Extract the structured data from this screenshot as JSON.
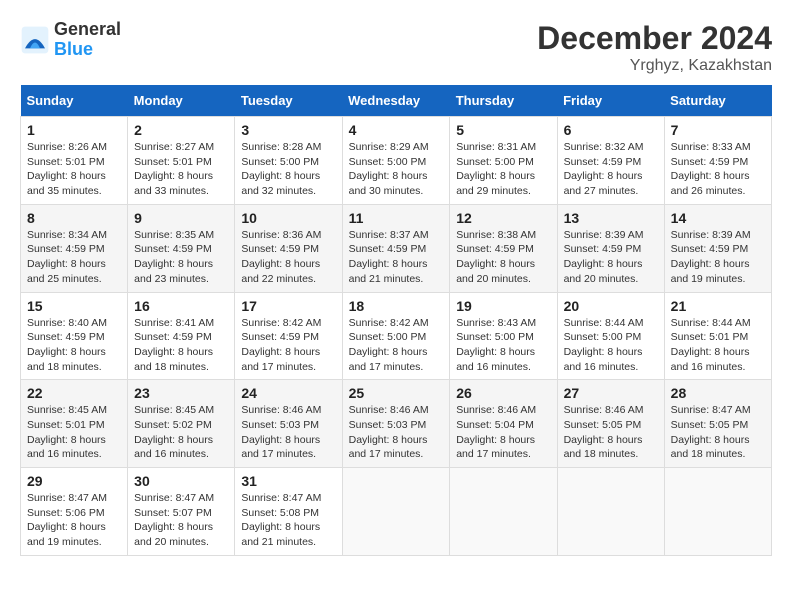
{
  "logo": {
    "text_general": "General",
    "text_blue": "Blue"
  },
  "header": {
    "month": "December 2024",
    "location": "Yrghyz, Kazakhstan"
  },
  "weekdays": [
    "Sunday",
    "Monday",
    "Tuesday",
    "Wednesday",
    "Thursday",
    "Friday",
    "Saturday"
  ],
  "weeks": [
    [
      {
        "day": "1",
        "sunrise": "8:26 AM",
        "sunset": "5:01 PM",
        "daylight": "8 hours and 35 minutes."
      },
      {
        "day": "2",
        "sunrise": "8:27 AM",
        "sunset": "5:01 PM",
        "daylight": "8 hours and 33 minutes."
      },
      {
        "day": "3",
        "sunrise": "8:28 AM",
        "sunset": "5:00 PM",
        "daylight": "8 hours and 32 minutes."
      },
      {
        "day": "4",
        "sunrise": "8:29 AM",
        "sunset": "5:00 PM",
        "daylight": "8 hours and 30 minutes."
      },
      {
        "day": "5",
        "sunrise": "8:31 AM",
        "sunset": "5:00 PM",
        "daylight": "8 hours and 29 minutes."
      },
      {
        "day": "6",
        "sunrise": "8:32 AM",
        "sunset": "4:59 PM",
        "daylight": "8 hours and 27 minutes."
      },
      {
        "day": "7",
        "sunrise": "8:33 AM",
        "sunset": "4:59 PM",
        "daylight": "8 hours and 26 minutes."
      }
    ],
    [
      {
        "day": "8",
        "sunrise": "8:34 AM",
        "sunset": "4:59 PM",
        "daylight": "8 hours and 25 minutes."
      },
      {
        "day": "9",
        "sunrise": "8:35 AM",
        "sunset": "4:59 PM",
        "daylight": "8 hours and 23 minutes."
      },
      {
        "day": "10",
        "sunrise": "8:36 AM",
        "sunset": "4:59 PM",
        "daylight": "8 hours and 22 minutes."
      },
      {
        "day": "11",
        "sunrise": "8:37 AM",
        "sunset": "4:59 PM",
        "daylight": "8 hours and 21 minutes."
      },
      {
        "day": "12",
        "sunrise": "8:38 AM",
        "sunset": "4:59 PM",
        "daylight": "8 hours and 20 minutes."
      },
      {
        "day": "13",
        "sunrise": "8:39 AM",
        "sunset": "4:59 PM",
        "daylight": "8 hours and 20 minutes."
      },
      {
        "day": "14",
        "sunrise": "8:39 AM",
        "sunset": "4:59 PM",
        "daylight": "8 hours and 19 minutes."
      }
    ],
    [
      {
        "day": "15",
        "sunrise": "8:40 AM",
        "sunset": "4:59 PM",
        "daylight": "8 hours and 18 minutes."
      },
      {
        "day": "16",
        "sunrise": "8:41 AM",
        "sunset": "4:59 PM",
        "daylight": "8 hours and 18 minutes."
      },
      {
        "day": "17",
        "sunrise": "8:42 AM",
        "sunset": "4:59 PM",
        "daylight": "8 hours and 17 minutes."
      },
      {
        "day": "18",
        "sunrise": "8:42 AM",
        "sunset": "5:00 PM",
        "daylight": "8 hours and 17 minutes."
      },
      {
        "day": "19",
        "sunrise": "8:43 AM",
        "sunset": "5:00 PM",
        "daylight": "8 hours and 16 minutes."
      },
      {
        "day": "20",
        "sunrise": "8:44 AM",
        "sunset": "5:00 PM",
        "daylight": "8 hours and 16 minutes."
      },
      {
        "day": "21",
        "sunrise": "8:44 AM",
        "sunset": "5:01 PM",
        "daylight": "8 hours and 16 minutes."
      }
    ],
    [
      {
        "day": "22",
        "sunrise": "8:45 AM",
        "sunset": "5:01 PM",
        "daylight": "8 hours and 16 minutes."
      },
      {
        "day": "23",
        "sunrise": "8:45 AM",
        "sunset": "5:02 PM",
        "daylight": "8 hours and 16 minutes."
      },
      {
        "day": "24",
        "sunrise": "8:46 AM",
        "sunset": "5:03 PM",
        "daylight": "8 hours and 17 minutes."
      },
      {
        "day": "25",
        "sunrise": "8:46 AM",
        "sunset": "5:03 PM",
        "daylight": "8 hours and 17 minutes."
      },
      {
        "day": "26",
        "sunrise": "8:46 AM",
        "sunset": "5:04 PM",
        "daylight": "8 hours and 17 minutes."
      },
      {
        "day": "27",
        "sunrise": "8:46 AM",
        "sunset": "5:05 PM",
        "daylight": "8 hours and 18 minutes."
      },
      {
        "day": "28",
        "sunrise": "8:47 AM",
        "sunset": "5:05 PM",
        "daylight": "8 hours and 18 minutes."
      }
    ],
    [
      {
        "day": "29",
        "sunrise": "8:47 AM",
        "sunset": "5:06 PM",
        "daylight": "8 hours and 19 minutes."
      },
      {
        "day": "30",
        "sunrise": "8:47 AM",
        "sunset": "5:07 PM",
        "daylight": "8 hours and 20 minutes."
      },
      {
        "day": "31",
        "sunrise": "8:47 AM",
        "sunset": "5:08 PM",
        "daylight": "8 hours and 21 minutes."
      },
      null,
      null,
      null,
      null
    ]
  ],
  "labels": {
    "sunrise": "Sunrise:",
    "sunset": "Sunset:",
    "daylight": "Daylight:"
  }
}
